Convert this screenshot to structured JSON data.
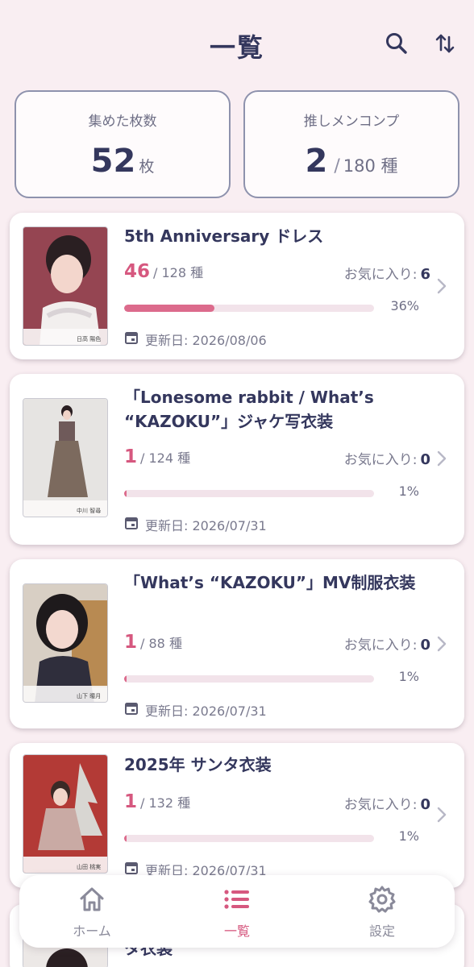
{
  "header": {
    "title": "一覧"
  },
  "stats": {
    "collected": {
      "label": "集めた枚数",
      "value": "52",
      "unit": "枚"
    },
    "oshi_comp": {
      "label": "推しメンコンプ",
      "value": "2",
      "separator": "/",
      "total": "180 種"
    }
  },
  "cards": [
    {
      "title": "5th Anniversary ドレス",
      "count": "46",
      "of_total": "/ 128 種",
      "fav_label": "お気に入り:",
      "fav_count": "6",
      "progress": 0.36,
      "progress_label": "36%",
      "date": "更新日: 2026/08/06",
      "photo_name": "日高 陽色"
    },
    {
      "title": "「Lonesome rabbit / What’s “KAZOKU”」ジャケ写衣装",
      "count": "1",
      "of_total": "/ 124 種",
      "fav_label": "お気に入り:",
      "fav_count": "0",
      "progress": 0.01,
      "progress_label": "1%",
      "date": "更新日: 2026/07/31",
      "photo_name": "中川 智尋"
    },
    {
      "title": "「What’s “KAZOKU”」MV制服衣装",
      "count": "1",
      "of_total": "/ 88 種",
      "fav_label": "お気に入り:",
      "fav_count": "0",
      "progress": 0.01,
      "progress_label": "1%",
      "date": "更新日: 2026/07/31",
      "photo_name": "山下 瞳月"
    },
    {
      "title": "2025年 サンタ衣装",
      "count": "1",
      "of_total": "/ 132 種",
      "fav_label": "お気に入り:",
      "fav_count": "0",
      "progress": 0.01,
      "progress_label": "1%",
      "date": "更新日: 2026/07/31",
      "photo_name": "山田 桃実"
    },
    {
      "title": "タ衣装"
    }
  ],
  "nav": {
    "home_label": "ホーム",
    "list_label": "一覧",
    "settings_label": "設定"
  },
  "colors": {
    "background": "#f9eef2",
    "accent": "#d6587f",
    "navy": "#34375d",
    "bar_track": "#f2e3ea"
  },
  "icons": [
    "search-icon",
    "sort-icon",
    "calendar-icon",
    "chevron-right-icon",
    "home-icon",
    "list-icon",
    "gear-icon"
  ]
}
